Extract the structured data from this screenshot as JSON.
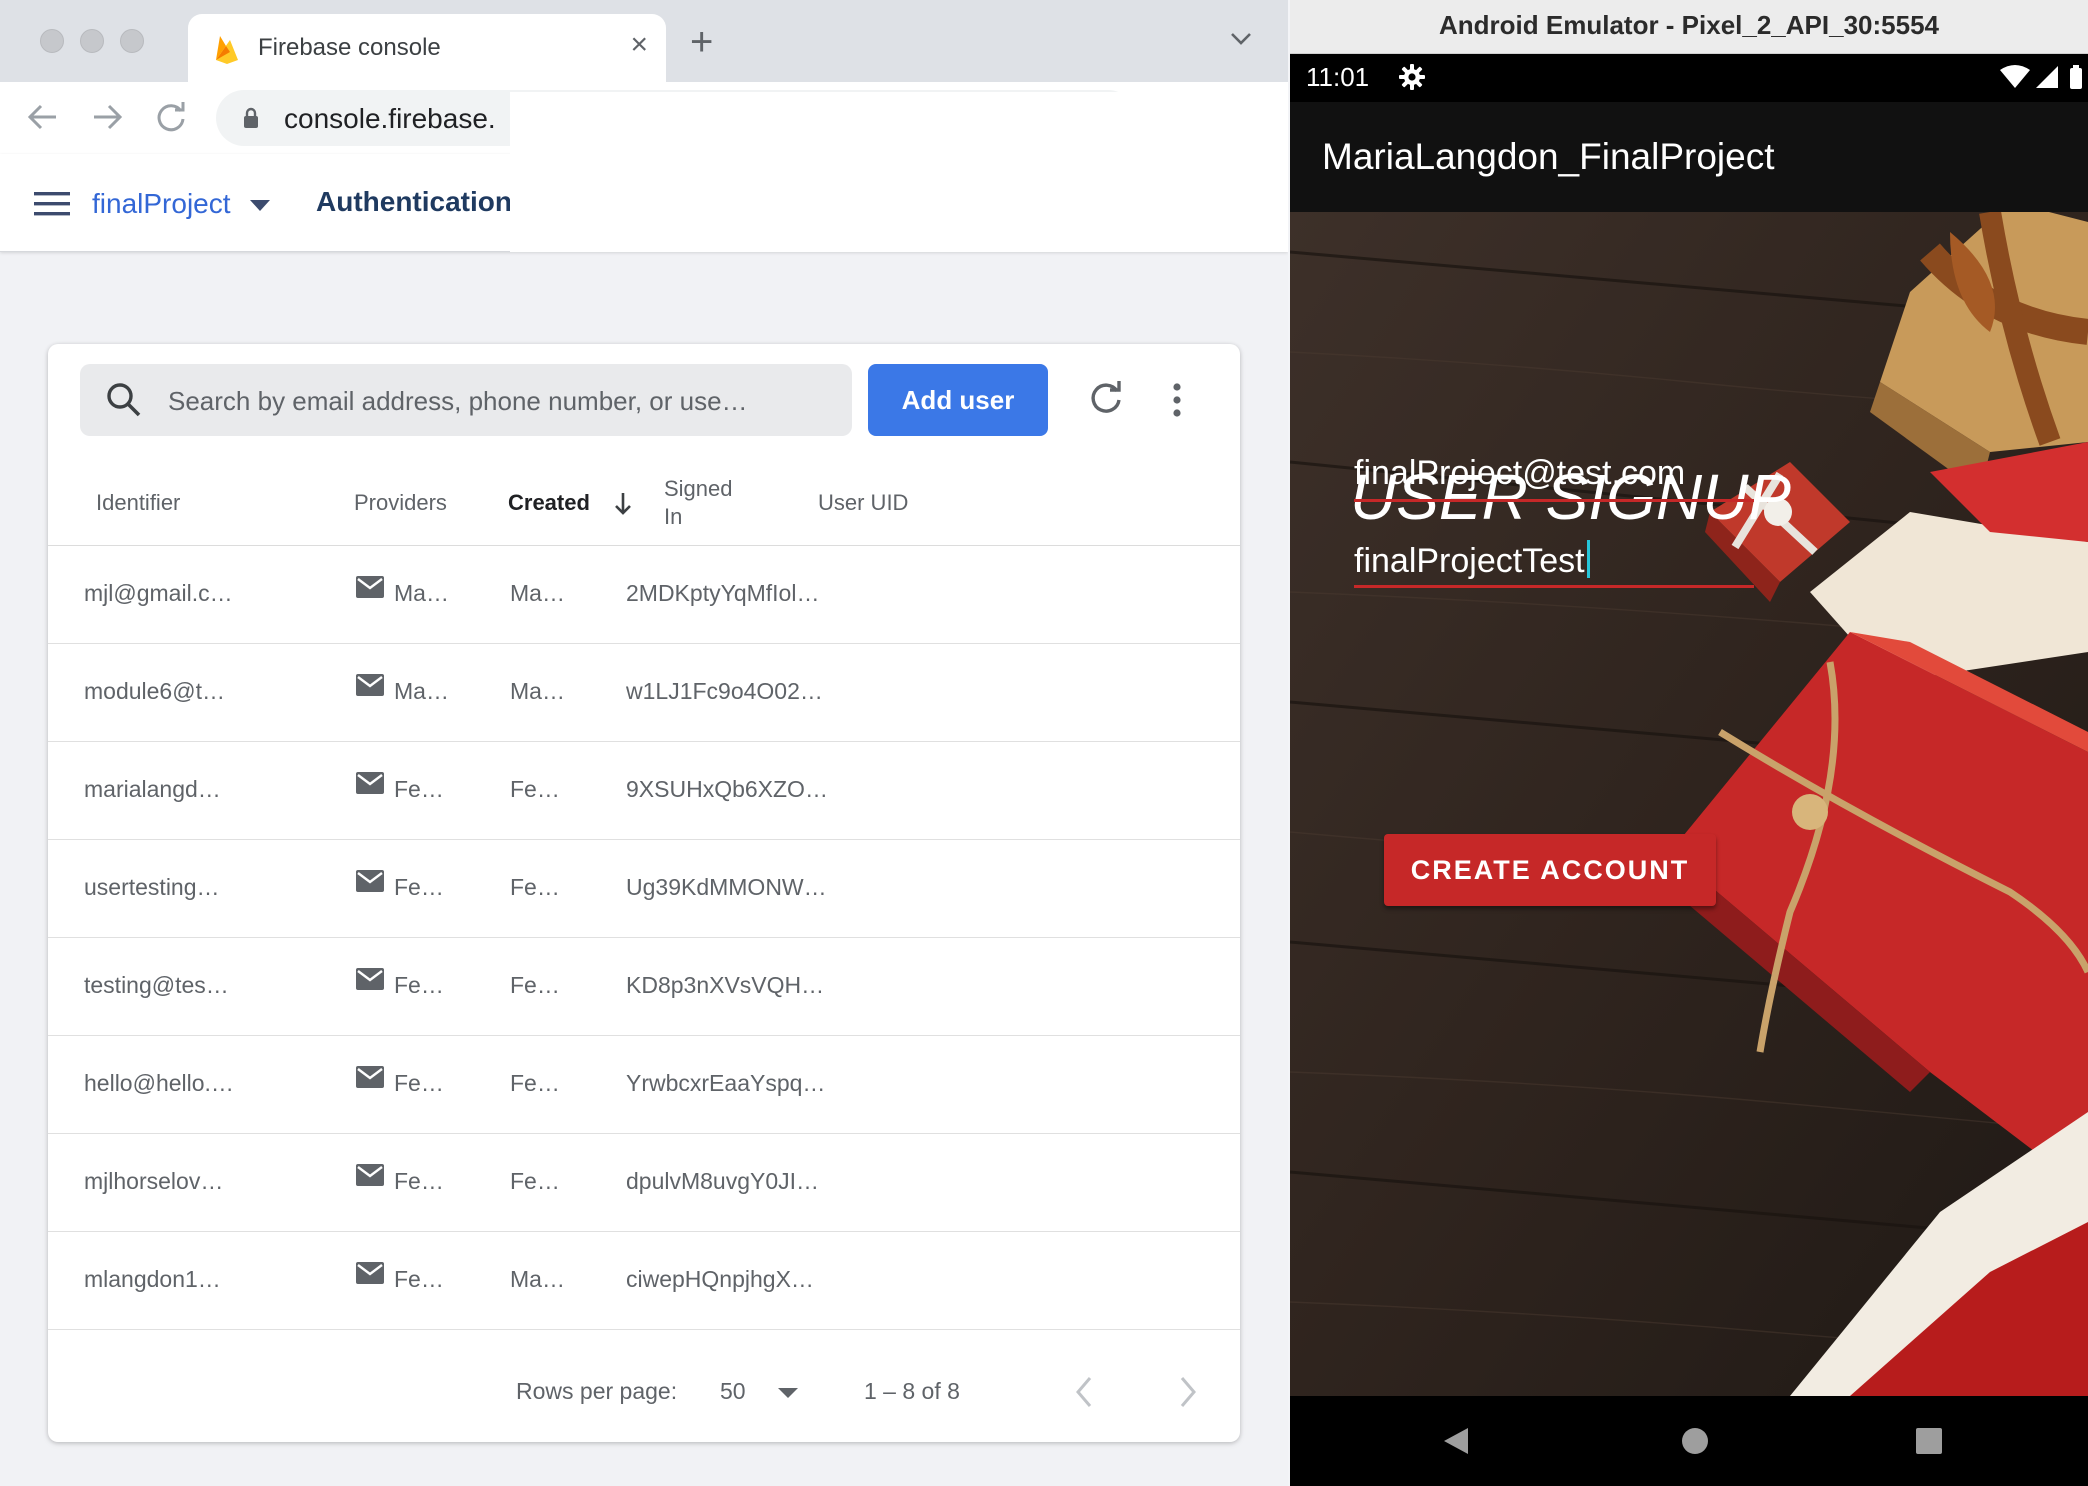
{
  "browser": {
    "tab_title": "Firebase console",
    "url": "console.firebase.",
    "project_name": "finalProject",
    "section": "Authentication"
  },
  "users": {
    "search_placeholder": "Search by email address, phone number, or use…",
    "add_user_label": "Add user",
    "columns": {
      "identifier": "Identifier",
      "providers": "Providers",
      "created": "Created",
      "signed_in_1": "Signed",
      "signed_in_2": "In",
      "uid": "User UID"
    },
    "rows": [
      {
        "identifier": "mjl@gmail.c…",
        "created": "Ma…",
        "signed_in": "Ma…",
        "uid": "2MDKptyYqMfIol…"
      },
      {
        "identifier": "module6@t…",
        "created": "Ma…",
        "signed_in": "Ma…",
        "uid": "w1LJ1Fc9o4O02…"
      },
      {
        "identifier": "marialangd…",
        "created": "Fe…",
        "signed_in": "Fe…",
        "uid": "9XSUHxQb6XZO…"
      },
      {
        "identifier": "usertesting…",
        "created": "Fe…",
        "signed_in": "Fe…",
        "uid": "Ug39KdMMONW…"
      },
      {
        "identifier": "testing@tes…",
        "created": "Fe…",
        "signed_in": "Fe…",
        "uid": "KD8p3nXVsVQH…"
      },
      {
        "identifier": "hello@hello.…",
        "created": "Fe…",
        "signed_in": "Fe…",
        "uid": "YrwbcxrEaaYspq…"
      },
      {
        "identifier": "mjlhorselov…",
        "created": "Fe…",
        "signed_in": "Fe…",
        "uid": "dpulvM8uvgY0JI…"
      },
      {
        "identifier": "mlangdon1…",
        "created": "Fe…",
        "signed_in": "Ma…",
        "uid": "ciwepHQnpjhgX…"
      }
    ],
    "pagination": {
      "rows_per_page_label": "Rows per page:",
      "rows_per_page": "50",
      "range": "1 – 8 of 8"
    }
  },
  "emulator": {
    "window_title": "Android Emulator - Pixel_2_API_30:5554",
    "time": "11:01",
    "app_title": "MariaLangdon_FinalProject",
    "signup_title": "USER SIGNUP",
    "email_value": "finalProject@test.com",
    "password_value": "finalProjectTest",
    "create_button": "CREATE ACCOUNT"
  },
  "icons": {
    "favicon": "firebase-flame-icon",
    "provider": "email-envelope-icon",
    "search": "search-icon",
    "refresh": "refresh-icon",
    "more": "more-vert-icon"
  },
  "colors": {
    "primary_button": "#3b78e7",
    "android_accent": "#c62828",
    "cursor": "#26c6da"
  }
}
